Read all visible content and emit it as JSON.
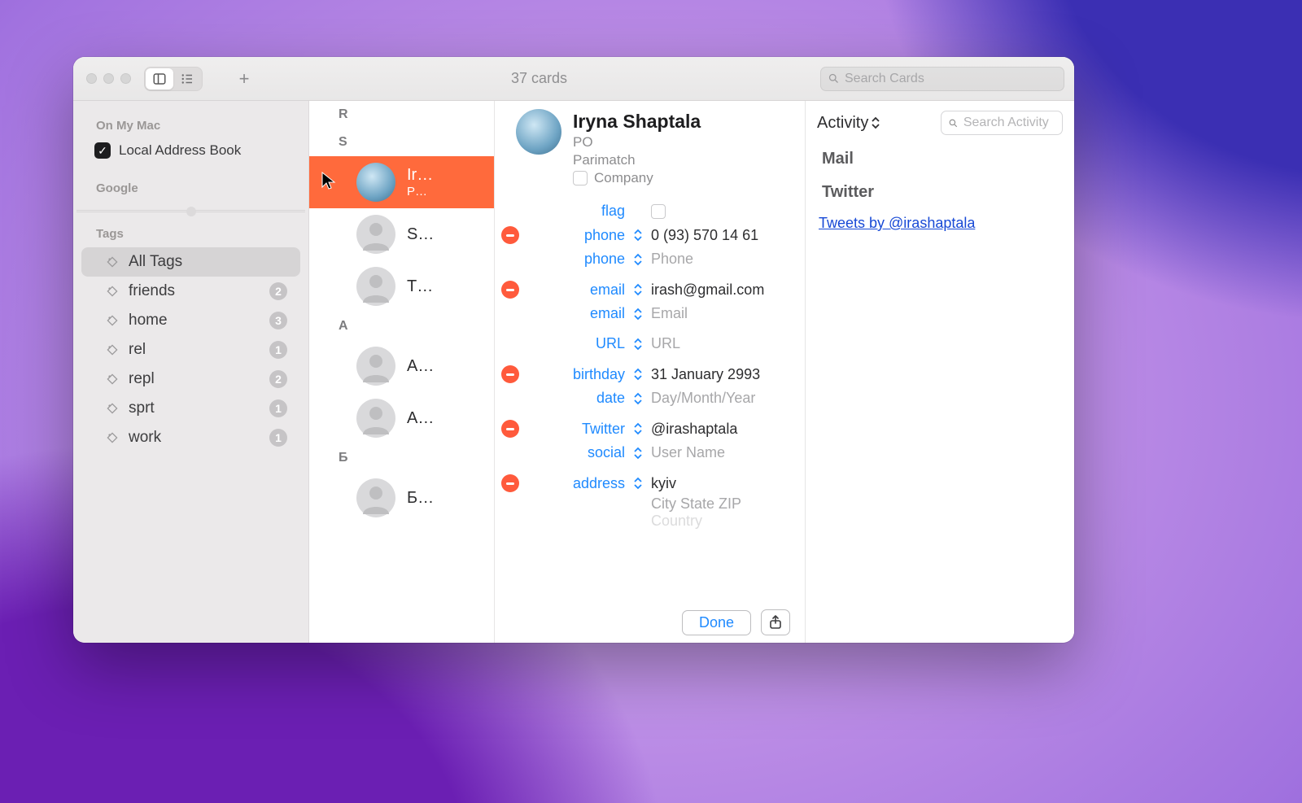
{
  "toolbar": {
    "title": "37 cards",
    "search_placeholder": "Search Cards"
  },
  "sidebar": {
    "on_my_mac_title": "On My Mac",
    "local_label": "Local Address Book",
    "google_title": "Google",
    "tags_title": "Tags",
    "tags": [
      {
        "label": "All Tags",
        "count": null,
        "selected": true
      },
      {
        "label": "friends",
        "count": "2",
        "selected": false
      },
      {
        "label": "home",
        "count": "3",
        "selected": false
      },
      {
        "label": "rel",
        "count": "1",
        "selected": false
      },
      {
        "label": "repl",
        "count": "2",
        "selected": false
      },
      {
        "label": "sprt",
        "count": "1",
        "selected": false
      },
      {
        "label": "work",
        "count": "1",
        "selected": false
      }
    ]
  },
  "list": {
    "sections": [
      {
        "letter": "R",
        "rows": []
      },
      {
        "letter": "S",
        "rows": [
          {
            "name": "Ir…",
            "sub": "P…",
            "selected": true,
            "photo": true
          },
          {
            "name": "S…",
            "sub": "",
            "selected": false,
            "photo": false
          },
          {
            "name": "T…",
            "sub": "",
            "selected": false,
            "photo": false
          }
        ]
      },
      {
        "letter": "A",
        "rows": [
          {
            "name": "A…",
            "sub": "",
            "selected": false,
            "photo": false
          },
          {
            "name": "A…",
            "sub": "",
            "selected": false,
            "photo": false
          }
        ]
      },
      {
        "letter": "Б",
        "rows": [
          {
            "name": "Б…",
            "sub": "",
            "selected": false,
            "photo": false
          }
        ]
      }
    ]
  },
  "detail": {
    "name": "Iryna Shaptala",
    "title": "PO",
    "org": "Parimatch",
    "company_label": "Company",
    "fields": {
      "flag_label": "flag",
      "phone1_label": "phone",
      "phone1_value": "0 (93) 570 14 61",
      "phone2_label": "phone",
      "phone2_placeholder": "Phone",
      "email1_label": "email",
      "email1_value": "irash@gmail.com",
      "email2_label": "email",
      "email2_placeholder": "Email",
      "url_label": "URL",
      "url_placeholder": "URL",
      "birthday_label": "birthday",
      "birthday_value": "31 January 2993",
      "date_label": "date",
      "date_placeholder": "Day/Month/Year",
      "twitter_label": "Twitter",
      "twitter_value": "@irashaptala",
      "social_label": "social",
      "social_placeholder": "User Name",
      "address_label": "address",
      "address_value": "kyiv",
      "address_line2": "City  State  ZIP",
      "address_line3": "Country"
    },
    "done": "Done"
  },
  "activity": {
    "title": "Activity",
    "search_placeholder": "Search Activity",
    "mail_section": "Mail",
    "twitter_section": "Twitter",
    "tweets_link": "Tweets by @irashaptala"
  }
}
